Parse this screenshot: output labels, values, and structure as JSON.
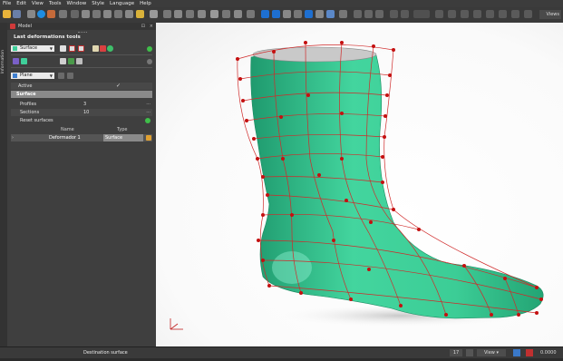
{
  "menu": [
    "File",
    "Edit",
    "View",
    "Tools",
    "Window",
    "Style",
    "Language",
    "Help"
  ],
  "toolbar": {
    "views_label": "Views"
  },
  "sidebar_strip_label": "Information",
  "panel": {
    "title": "Model",
    "tool_title": "Last deformations tools",
    "surface_select": "Surface",
    "plane_select": "Plane",
    "active_label": "Active",
    "active_check": "✓",
    "section_header": "Surface",
    "profiles_label": "Profiles",
    "profiles_value": "3",
    "sections_label": "Sections",
    "sections_value": "10",
    "reset_label": "Reset surfaces",
    "table_headers": [
      "Name",
      "Type"
    ],
    "deformers": [
      {
        "name": "Deformador 1",
        "type": "Surface"
      }
    ]
  },
  "status": {
    "destination": "Destination surface",
    "zoom_value": "17",
    "view_select": "View",
    "coord_value": "0.0000"
  },
  "colors": {
    "surface": "#3fcf9a",
    "cage": "#d23030",
    "panel": "#3f3f3f"
  }
}
